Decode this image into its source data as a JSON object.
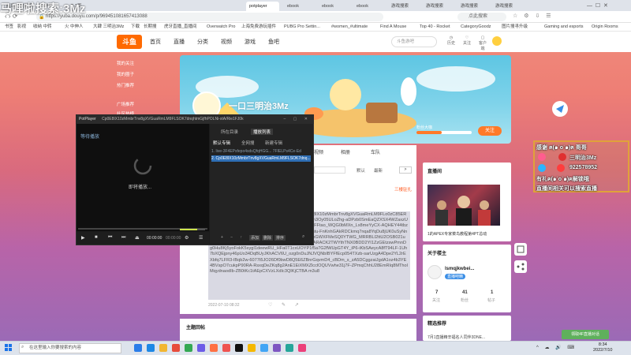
{
  "browser": {
    "tabs": [
      {
        "label": "雨后小故事新",
        "active": false
      },
      {
        "label": "动作片"
      },
      {
        "label": "3-1页"
      },
      {
        "label": "potplayer",
        "active": true
      },
      {
        "label": "ebook"
      },
      {
        "label": "ebook"
      },
      {
        "label": "ebook"
      },
      {
        "label": "游戏搜索"
      },
      {
        "label": "游戏搜索"
      },
      {
        "label": "游戏搜索"
      },
      {
        "label": "游戏搜索"
      }
    ],
    "url": "https://yuba.douyu.com/p/969451081657413088",
    "search_placeholder": "点此搜索",
    "bookmarks": [
      "书签",
      "影视",
      "收纳 中转",
      "火 中伸人",
      "大肆 三明治3Mz",
      "下载",
      "长期搜",
      "虎牙直播_直播间",
      "Overwatch Pro",
      "上海免费游玩插件",
      "PUBG Pro Settin...",
      "#women_#ultimate",
      "Find A Mouse",
      "Top 40 - Rocket",
      "CategoryGoodz",
      "图片搜寻升级",
      "Gaming and esports",
      "Origin Rooms"
    ]
  },
  "watermark": "马哩啦搜索:3Mz",
  "site": {
    "logo": "斗鱼",
    "nav": [
      "首页",
      "直播",
      "分类",
      "视频",
      "游戏",
      "鱼吧"
    ],
    "search_placeholder": "斗鱼游吧",
    "header_icons": [
      "历史",
      "关注",
      "客户端",
      "看世界",
      "开播"
    ],
    "sidebar": [
      "我的关注",
      "我的圈子",
      "热门推荐",
      "广场推荐",
      "社区热榜"
    ]
  },
  "room": {
    "title": "一口三明治3Mz",
    "subscribe_label": "关注",
    "fans_label": "粉丝大咖",
    "tabs": [
      "视频",
      "相册",
      "车队"
    ],
    "sort_options": [
      "默认",
      "最新"
    ],
    "expand": "三楼驻扎"
  },
  "post": {
    "text": "fFpgiGxC4EcudHI1dcJUZhWZvMmDI3EYg0hf/Cp0E8IX10zMmbrTnv8gXVGuaRmLM9FLo0zC85ERhm5NnPJCemZJDHuqlbYIVSQ8DZ8frYRZMpHV0Rm3Oy05ULoZhg-aDPzb0SmEaQZXSX4WZaxzUyuU6zLHd5xaZf7mUzMQZgInNDOYNBPgwcvi-YXh1FFtao_WQG0bMXn_Lx8meYyCX-AQHEY44tbzDmvC8ESfMCd61UUhqSGDBthNeJuuJMaOYa8B2mtu-FnKnhGAkRDCkmq7nqa8YqDu8jUK0uSyNnHXlhvvD9e1bT-wohntwPXOLKgLSOK7DKGLp7CLBhGWXFMeSQ0YTWG_MRRBLI2ttU2OSB021uOU2Qz3mzZmhhYFC6QUEiEvpitQUL_4QBYtgbbbEARACK2TWYthTNX0BDD2YI1ZzGEtzswPmnDg0Hu8Kj5yoFokK5sygI1deewRU_HFa0T1cxUOYP1f5a7G2fWUpGT4Y_iP6-iKbSAeycA8fT94LF-1Uh7bXQEjpny46pUo34DqBUyJKhACV6U_ozg0nDuJNJVQNbIBYFfEcp054TXzb-sarUzgA4Dpe2YL2rEXbfq7LFR3-lBqb2w-6077t5JO26Df0bwD8Q5E6ZBnrGqvmD4_cBDm_s_zA5DCggzaiJgdA1oz4b3YE4BVspO7cukpP90RA-RsxqDeZKq8g2AnE1EiXMXZlcclOQUVwhe31j7F-ZPmqChhU28EmRIq8MTholMqydnaodIb-ZB0tKc1tAEpCXVzLXdIc3QIKjCTBA m3u8",
    "meta": "2022-07-10 08:32",
    "section_title": "主题回帖"
  },
  "cards": {
    "live_title": "直播间",
    "live_caption": "1的APEX专家菜鸟教程第4PT总动",
    "anchor_title": "关于楼主",
    "anchor_name": "lsmqjkwbei...",
    "anchor_badge": "直播吧精",
    "anchor_stats": [
      {
        "value": "7",
        "label": "关注"
      },
      {
        "value": "41",
        "label": "粉丝"
      },
      {
        "value": "1",
        "label": "帖子"
      }
    ],
    "recommend_title": "精选推荐",
    "recommend_item": "7月1直播精辛福名人同伴3DNE...",
    "chat_notice": "领取4F直播对话"
  },
  "overlay": {
    "line1": "感谢 ฅ(๑˙o˙๑)ฅ 哥哥",
    "line2": "三明治3Mz",
    "line3": "922578952",
    "line4": "有礼ฅ(๑˙o˙๑)ฅ解锁哦",
    "line5": "直播间相关可以搜索直播"
  },
  "potplayer": {
    "title": "PotPlayer",
    "file_title": "Cp0E8IX10zMmbrTnv8gXVGuaRmLM9FLSOK7dnqhtmGjfhPOLNi-xtA/Rie1FJ0kM",
    "status": "等待播放",
    "loading": "即将播放...",
    "tabs": [
      "所在目录",
      "播放列表"
    ],
    "subtabs": [
      "默认专辑",
      "全网搜",
      "新建专辑"
    ],
    "items": [
      "1. live-3F4EPsfepo4sdsQfqHGG... 7FIELPs4Ce-Ed",
      "2. Cp0E8IX10zMmbrTnv8gXVGuaRmLM9FLSOK7dnq..."
    ],
    "time_current": "00:00:00",
    "time_total": "00:00:00",
    "bottom_buttons": [
      "添加",
      "删除",
      "排序"
    ]
  },
  "taskbar": {
    "search_placeholder": "在这里输入你要搜索的内容",
    "time": "8:34",
    "date": "2022/7/10"
  }
}
